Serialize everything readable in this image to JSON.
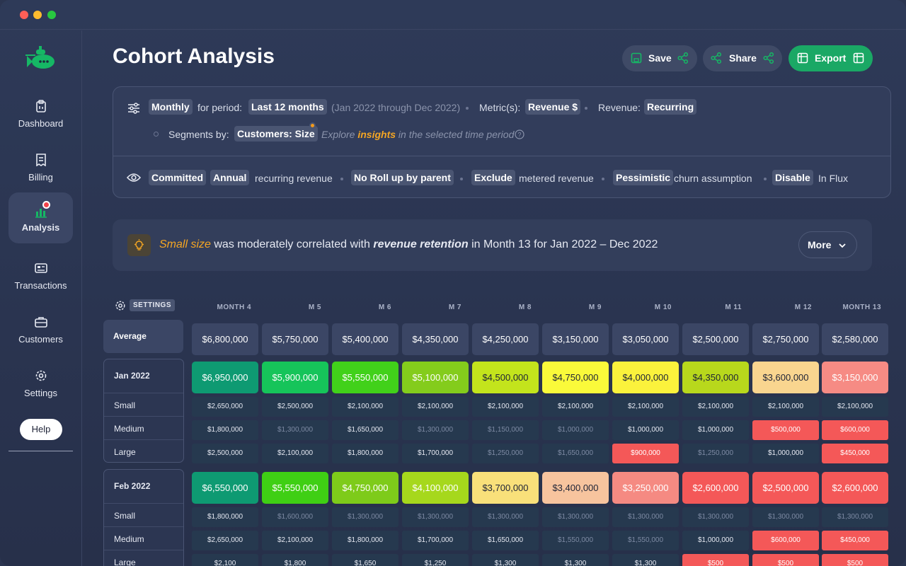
{
  "app": {
    "title": "Cohort Analysis"
  },
  "sidebar": {
    "items": [
      {
        "label": "Dashboard",
        "icon": "clipboard-icon"
      },
      {
        "label": "Billing",
        "icon": "receipt-icon"
      },
      {
        "label": "Analysis",
        "icon": "bar-chart-icon",
        "active": true
      },
      {
        "label": "Transactions",
        "icon": "card-icon"
      },
      {
        "label": "Customers",
        "icon": "briefcase-icon"
      },
      {
        "label": "Settings",
        "icon": "gear-icon"
      }
    ],
    "help_label": "Help"
  },
  "toolbar": {
    "save_label": "Save",
    "share_label": "Share",
    "export_label": "Export"
  },
  "filters": {
    "interval": "Monthly",
    "for_period_label": "for period:",
    "period": "Last 12 months",
    "period_range": "(Jan 2022 through Dec 2022)",
    "metrics_label": "Metric(s):",
    "metric": "Revenue $",
    "revenue_label": "Revenue:",
    "revenue_type": "Recurring",
    "segments_label": "Segments by:",
    "segment": "Customers: Size",
    "explore_prefix": "Explore",
    "explore_highlight": "insights",
    "explore_suffix": "in the selected time period",
    "committed": "Committed",
    "annual": "Annual",
    "recurring_revenue": "recurring revenue",
    "rollup": "No Roll up by parent",
    "exclude": "Exclude",
    "metered": "metered revenue",
    "pessimistic": "Pessimistic",
    "churn": "churn assumption",
    "disable": "Disable",
    "in_flux": "In Flux"
  },
  "insight": {
    "highlight": "Small size",
    "middle": "was moderately correlated with",
    "bold": "revenue retention",
    "tail": "in Month 13 for Jan 2022 – Dec 2022",
    "more_label": "More"
  },
  "table": {
    "settings_label": "SETTINGS",
    "columns": [
      "MONTH 4",
      "M 5",
      "M 6",
      "M 7",
      "M 8",
      "M 9",
      "M 10",
      "M 11",
      "M 12",
      "MONTH 13"
    ],
    "average_label": "Average",
    "average": [
      "$6,800,000",
      "$5,750,000",
      "$5,400,000",
      "$4,350,000",
      "$4,250,000",
      "$3,150,000",
      "$3,050,000",
      "$2,500,000",
      "$2,750,000",
      "$2,580,000"
    ],
    "cohorts": [
      {
        "label": "Jan 2022",
        "values": [
          "$6,950,000",
          "$5,900,000",
          "$5,550,000",
          "$5,100,000",
          "$4,500,000",
          "$4,750,000",
          "$4,000,000",
          "$4,350,000",
          "$3,600,000",
          "$3,150,000"
        ],
        "colors": [
          "#0e9a72",
          "#16c45a",
          "#41d11a",
          "#84cc1c",
          "#c3e41c",
          "#fafa3a",
          "#fbf23c",
          "#b8d81c",
          "#f9d58f",
          "#f68b84"
        ],
        "segments": [
          {
            "label": "Small",
            "values": [
              "$2,650,000",
              "$2,500,000",
              "$2,100,000",
              "$2,100,000",
              "$2,100,000",
              "$2,100,000",
              "$2,100,000",
              "$2,100,000",
              "$2,100,000",
              "$2,100,000"
            ]
          },
          {
            "label": "Medium",
            "values": [
              "$1,800,000",
              "$1,300,000",
              "$1,650,000",
              "$1,300,000",
              "$1,150,000",
              "$1,000,000",
              "$1,000,000",
              "$1,000,000",
              "$500,000",
              "$600,000"
            ]
          },
          {
            "label": "Large",
            "values": [
              "$2,500,000",
              "$2,100,000",
              "$1,800,000",
              "$1,700,000",
              "$1,250,000",
              "$1,650,000",
              "$900,000",
              "$1,250,000",
              "$1,000,000",
              "$450,000"
            ]
          }
        ]
      },
      {
        "label": "Feb 2022",
        "values": [
          "$6,550,000",
          "$5,550,000",
          "$4,750,000",
          "$4,100,000",
          "$3,700,000",
          "$3,400,000",
          "$3,250,000",
          "$2,600,000",
          "$2,500,000",
          "$2,600,000"
        ],
        "colors": [
          "#0e9a72",
          "#3fcf14",
          "#7ecb1a",
          "#a6d81c",
          "#f9e07a",
          "#f7c49e",
          "#f58a82",
          "#f45858",
          "#f45858",
          "#f45858"
        ],
        "segments": [
          {
            "label": "Small",
            "values": [
              "$1,800,000",
              "$1,600,000",
              "$1,300,000",
              "$1,300,000",
              "$1,300,000",
              "$1,300,000",
              "$1,300,000",
              "$1,300,000",
              "$1,300,000",
              "$1,300,000"
            ]
          },
          {
            "label": "Medium",
            "values": [
              "$2,650,000",
              "$2,100,000",
              "$1,800,000",
              "$1,700,000",
              "$1,650,000",
              "$1,550,000",
              "$1,550,000",
              "$1,000,000",
              "$600,000",
              "$450,000"
            ]
          },
          {
            "label": "Large",
            "values": [
              "$2,100",
              "$1,800",
              "$1,650",
              "$1,250",
              "$1,300",
              "$1,300",
              "$1,300",
              "$500",
              "$500",
              "$500"
            ]
          }
        ]
      }
    ]
  },
  "colors": {
    "accent": "#1aa865",
    "warning": "#f5a623",
    "negative": "#f45858"
  }
}
